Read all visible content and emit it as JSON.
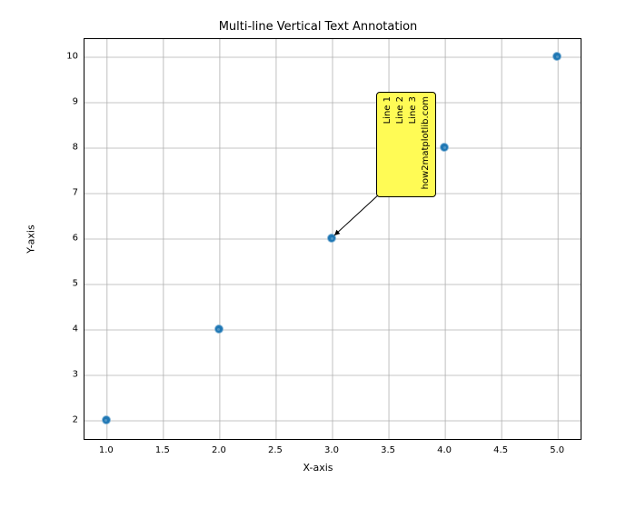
{
  "chart_data": {
    "type": "scatter",
    "title": "Multi-line Vertical Text Annotation",
    "xlabel": "X-axis",
    "ylabel": "Y-axis",
    "xlim": [
      0.8,
      5.2
    ],
    "ylim": [
      1.6,
      10.4
    ],
    "x": [
      1,
      2,
      3,
      4,
      5
    ],
    "y": [
      2,
      4,
      6,
      8,
      10
    ],
    "xticks": [
      1.0,
      1.5,
      2.0,
      2.5,
      3.0,
      3.5,
      4.0,
      4.5,
      5.0
    ],
    "xtick_labels": [
      "1.0",
      "1.5",
      "2.0",
      "2.5",
      "3.0",
      "3.5",
      "4.0",
      "4.5",
      "5.0"
    ],
    "yticks": [
      2,
      3,
      4,
      5,
      6,
      7,
      8,
      9,
      10
    ],
    "ytick_labels": [
      "2",
      "3",
      "4",
      "5",
      "6",
      "7",
      "8",
      "9",
      "10"
    ],
    "grid": true,
    "annotation": {
      "text_lines": [
        "Line 1",
        "Line 2",
        "Line 3",
        "how2matplotlib.com"
      ],
      "xy": [
        3,
        6
      ],
      "xytext_approx": [
        3.5,
        7
      ],
      "rotation": "vertical",
      "bbox_facecolor": "yellow",
      "bbox_alpha": 0.5
    }
  }
}
